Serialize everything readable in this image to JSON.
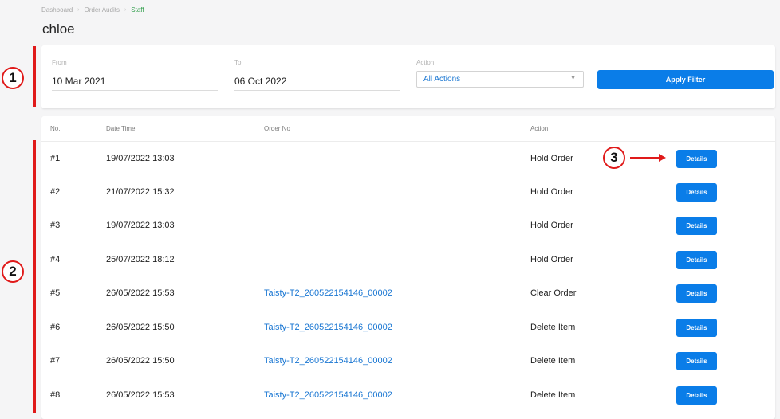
{
  "breadcrumb": [
    "Dashboard",
    "Order Audits",
    "Staff"
  ],
  "breadcrumb_separator": "›",
  "page_title": "chloe",
  "filter": {
    "from_label": "From",
    "from_value": "10 Mar 2021",
    "to_label": "To",
    "to_value": "06 Oct 2022",
    "action_label": "Action",
    "action_value": "All Actions",
    "apply_label": "Apply Filter"
  },
  "table": {
    "headers": [
      "No.",
      "Date Time",
      "Order No",
      "Action"
    ],
    "details_label": "Details",
    "rows": [
      {
        "no": "#1",
        "datetime": "19/07/2022 13:03",
        "order_no": "",
        "action": "Hold Order"
      },
      {
        "no": "#2",
        "datetime": "21/07/2022 15:32",
        "order_no": "",
        "action": "Hold Order"
      },
      {
        "no": "#3",
        "datetime": "19/07/2022 13:03",
        "order_no": "",
        "action": "Hold Order"
      },
      {
        "no": "#4",
        "datetime": "25/07/2022 18:12",
        "order_no": "",
        "action": "Hold Order"
      },
      {
        "no": "#5",
        "datetime": "26/05/2022 15:53",
        "order_no": "Taisty-T2_260522154146_00002",
        "action": "Clear Order"
      },
      {
        "no": "#6",
        "datetime": "26/05/2022 15:50",
        "order_no": "Taisty-T2_260522154146_00002",
        "action": "Delete Item"
      },
      {
        "no": "#7",
        "datetime": "26/05/2022 15:50",
        "order_no": "Taisty-T2_260522154146_00002",
        "action": "Delete Item"
      },
      {
        "no": "#8",
        "datetime": "26/05/2022 15:53",
        "order_no": "Taisty-T2_260522154146_00002",
        "action": "Delete Item"
      }
    ]
  },
  "annotations": {
    "marker_1": "1",
    "marker_2": "2",
    "marker_3": "3",
    "color": "#e01a1a"
  },
  "colors": {
    "primary": "#0a7de8",
    "link": "#1976d2",
    "breadcrumb_active": "#2e9d49"
  }
}
